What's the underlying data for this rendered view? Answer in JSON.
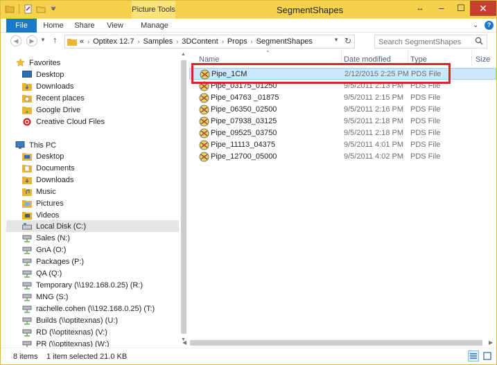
{
  "window": {
    "title": "SegmentShapes",
    "context_tab_group": "Picture Tools",
    "controls": {
      "minimize": "–",
      "maximize": "☐",
      "close": "✕",
      "resize": "↔"
    }
  },
  "ribbon": {
    "tabs": [
      "File",
      "Home",
      "Share",
      "View",
      "Manage"
    ]
  },
  "address": {
    "prefix": "«",
    "crumbs": [
      "Optitex 12.7",
      "Samples",
      "3DContent",
      "Props",
      "SegmentShapes"
    ]
  },
  "search": {
    "placeholder": "Search SegmentShapes"
  },
  "navigation": {
    "favorites_header": "Favorites",
    "favorites": [
      "Desktop",
      "Downloads",
      "Recent places",
      "Google Drive",
      "Creative Cloud Files"
    ],
    "thispc_header": "This PC",
    "thispc": [
      "Desktop",
      "Documents",
      "Downloads",
      "Music",
      "Pictures",
      "Videos",
      "Local Disk (C:)"
    ],
    "drives": [
      "Sales (N:)",
      "GnA (O:)",
      "Packages (P:)",
      "QA (Q:)",
      "Temporary (\\\\192.168.0.25) (R:)",
      "MNG (S:)",
      "rachelle.cohen (\\\\192.168.0.25) (T:)",
      "Builds (\\\\optitexnas) (U:)",
      "RD (\\\\optitexnas) (V:)",
      "PR (\\\\optitexnas) (W:)"
    ]
  },
  "columns": {
    "name": "Name",
    "date": "Date modified",
    "type": "Type",
    "size": "Size"
  },
  "files": [
    {
      "name": "Pipe_1CM",
      "date": "2/12/2015 2:25 PM",
      "type": "PDS File"
    },
    {
      "name": "Pipe_03175_01250",
      "date": "9/5/2011 2:13 PM",
      "type": "PDS File"
    },
    {
      "name": "Pipe_04763 _01875",
      "date": "9/5/2011 2:15 PM",
      "type": "PDS File"
    },
    {
      "name": "Pipe_06350_02500",
      "date": "9/5/2011 2:16 PM",
      "type": "PDS File"
    },
    {
      "name": "Pipe_07938_03125",
      "date": "9/5/2011 2:18 PM",
      "type": "PDS File"
    },
    {
      "name": "Pipe_09525_03750",
      "date": "9/5/2011 2:18 PM",
      "type": "PDS File"
    },
    {
      "name": "Pipe_11113_04375",
      "date": "9/5/2011 4:01 PM",
      "type": "PDS File"
    },
    {
      "name": "Pipe_12700_05000",
      "date": "9/5/2011 4:02 PM",
      "type": "PDS File"
    }
  ],
  "selected_index": 0,
  "status": {
    "items": "8 items",
    "selected": "1 item selected  21.0 KB"
  },
  "colors": {
    "title_bar": "#f5d24b",
    "file_tab": "#1979ca",
    "selection": "#cce8ff",
    "annotation": "#e0202b"
  }
}
